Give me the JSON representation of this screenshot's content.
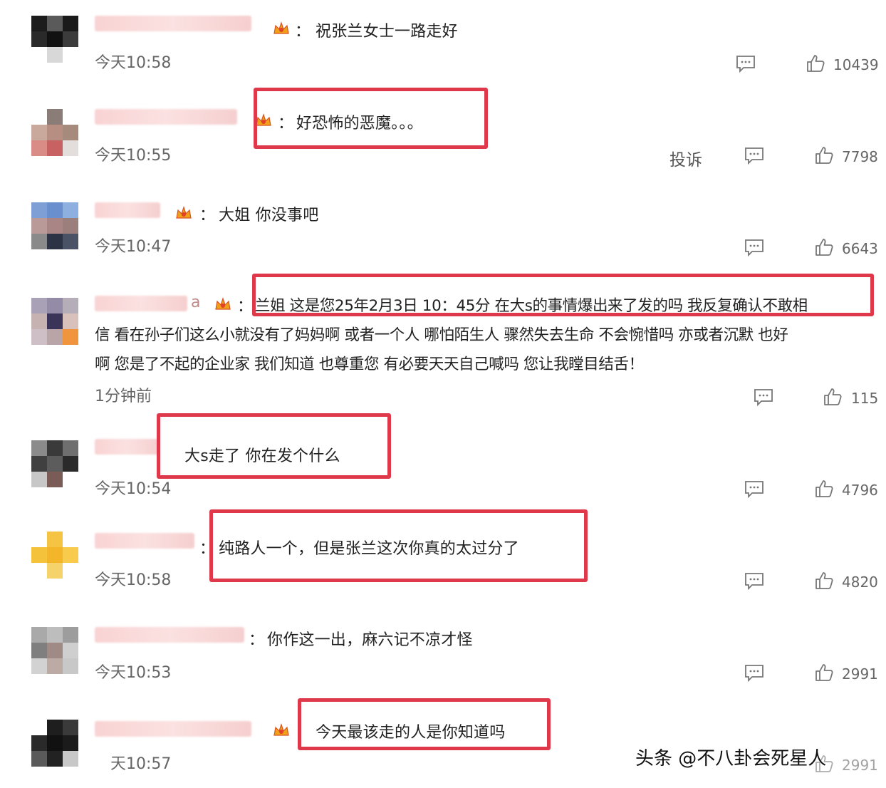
{
  "comments": [
    {
      "text": "祝张兰女士一路走好",
      "time": "今天10:58",
      "likes": "10439"
    },
    {
      "text": "好恐怖的恶魔。。。",
      "time": "今天10:55",
      "likes": "7798",
      "report": "投诉"
    },
    {
      "text": "大姐 你没事吧",
      "time": "今天10:47",
      "likes": "6643"
    },
    {
      "name_tail": "a",
      "text": "兰姐 这是您25年2月3日 10：45分 在大s的事情爆出来了发的吗 我反复确认不敢相",
      "text2": "信 看在孙子们这么小就没有了妈妈啊 或者一个人 哪怕陌生人 骤然失去生命 不会惋惜吗 亦或者沉默 也好",
      "text3": "啊 您是了不起的企业家 我们知道 也尊重您 有必要天天自己喊吗 您让我瞠目结舌！",
      "time": "1分钟前",
      "likes": "115"
    },
    {
      "text": "大s走了 你在发个什么",
      "time": "今天10:54",
      "likes": "4796"
    },
    {
      "text": "纯路人一个，但是张兰这次你真的太过分了",
      "time": "今天10:58",
      "likes": "4820"
    },
    {
      "text": "你作这一出，麻六记不凉才怪",
      "time": "今天10:53",
      "likes": "2991"
    },
    {
      "text": "今天最该走的人是你知道吗",
      "time": "天10:57",
      "likes": "2991"
    }
  ],
  "colon": "：",
  "watermark": "头条 @不八卦会死星人",
  "icons": {
    "reply": "comment-bubble-icon",
    "like": "thumbs-up-icon",
    "badge": "crown-badge-icon"
  },
  "colors": {
    "highlight": "#e0384b",
    "name_blur": "#f9d3d3",
    "time_text": "#666666"
  }
}
